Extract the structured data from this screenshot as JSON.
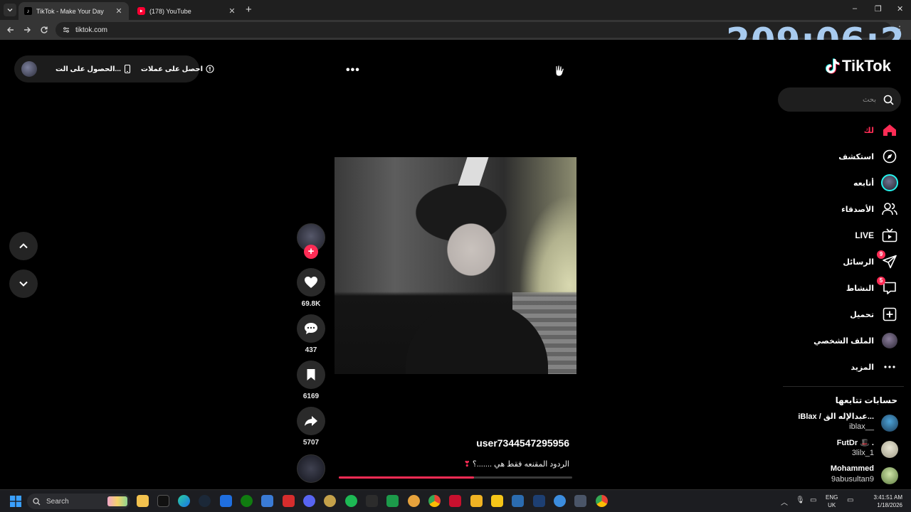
{
  "browser": {
    "tabs": [
      {
        "title": "TikTok - Make Your Day",
        "active": true
      },
      {
        "title": "(178) YouTube",
        "active": false
      }
    ],
    "new_tab": "+",
    "url": "tiktok.com",
    "window_controls": {
      "minimize": "–",
      "restore": "❐",
      "close": "✕"
    }
  },
  "overlay_timer": "209:06:2",
  "topbar": {
    "coins_label": "احصل على عملات",
    "app_label": "الحصول على الت..."
  },
  "more_menu": "•••",
  "video": {
    "username": "user7344547295956",
    "caption": "الردود المقنعه فقط هي .......؟",
    "progress_fraction": 0.58
  },
  "actions": {
    "likes": "69.8K",
    "comments": "437",
    "saves": "6169",
    "shares": "5707"
  },
  "sidebar": {
    "logo_text": "TikTok",
    "search_placeholder": "بحث",
    "nav": [
      {
        "label": "لك",
        "icon": "home-icon",
        "active": true
      },
      {
        "label": "استكشف",
        "icon": "compass-icon"
      },
      {
        "label": "أتابعه",
        "icon": "following-avatar-icon"
      },
      {
        "label": "الأصدقاء",
        "icon": "friends-icon"
      },
      {
        "label": "LIVE",
        "icon": "live-tv-icon"
      },
      {
        "label": "الرسائل",
        "icon": "messages-icon",
        "badge": "9"
      },
      {
        "label": "النشاط",
        "icon": "activity-icon",
        "badge": "5"
      },
      {
        "label": "تحميل",
        "icon": "upload-icon"
      },
      {
        "label": "الملف الشخصي",
        "icon": "profile-avatar-icon"
      },
      {
        "label": "المزيد",
        "icon": "more-icon"
      }
    ],
    "following_header": "حسابات تتابعها",
    "following": [
      {
        "name": "iBlax / عبدالإله الق...",
        "handle": "iblax__"
      },
      {
        "name": "FutDr 🎩 .",
        "handle": "3lilx_1"
      },
      {
        "name": "Mohammed",
        "handle": "9abusultan9"
      }
    ]
  },
  "taskbar": {
    "search_label": "Search",
    "lang_line1": "ENG",
    "lang_line2": "UK",
    "time": "3:41:51 AM",
    "date": "1/18/2026"
  },
  "colors": {
    "accent": "#fe2c55",
    "timer": "#a8cbef",
    "background": "#000000"
  }
}
